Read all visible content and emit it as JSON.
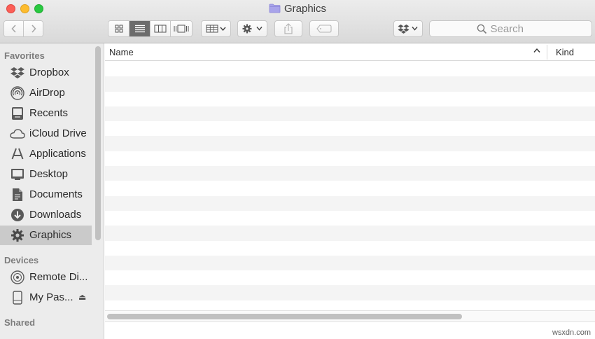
{
  "window": {
    "title": "Graphics"
  },
  "toolbar": {
    "search_placeholder": "Search"
  },
  "sidebar": {
    "sections": {
      "favorites": "Favorites",
      "devices": "Devices",
      "shared": "Shared"
    },
    "favorites": [
      {
        "label": "Dropbox",
        "icon": "dropbox-icon"
      },
      {
        "label": "AirDrop",
        "icon": "airdrop-icon"
      },
      {
        "label": "Recents",
        "icon": "recents-icon"
      },
      {
        "label": "iCloud Drive",
        "icon": "cloud-icon"
      },
      {
        "label": "Applications",
        "icon": "applications-icon"
      },
      {
        "label": "Desktop",
        "icon": "desktop-icon"
      },
      {
        "label": "Documents",
        "icon": "documents-icon"
      },
      {
        "label": "Downloads",
        "icon": "downloads-icon"
      },
      {
        "label": "Graphics",
        "icon": "gear-icon",
        "selected": true
      }
    ],
    "devices": [
      {
        "label": "Remote Di...",
        "icon": "disc-icon"
      },
      {
        "label": "My Pas...",
        "icon": "drive-icon",
        "eject": "⏏"
      }
    ]
  },
  "list": {
    "columns": {
      "name": "Name",
      "sort_indicator": "^",
      "kind": "Kind"
    }
  },
  "watermark": "wsxdn.com",
  "colors": {
    "selected": "#cacaca",
    "folder": "#a8a3ea"
  }
}
